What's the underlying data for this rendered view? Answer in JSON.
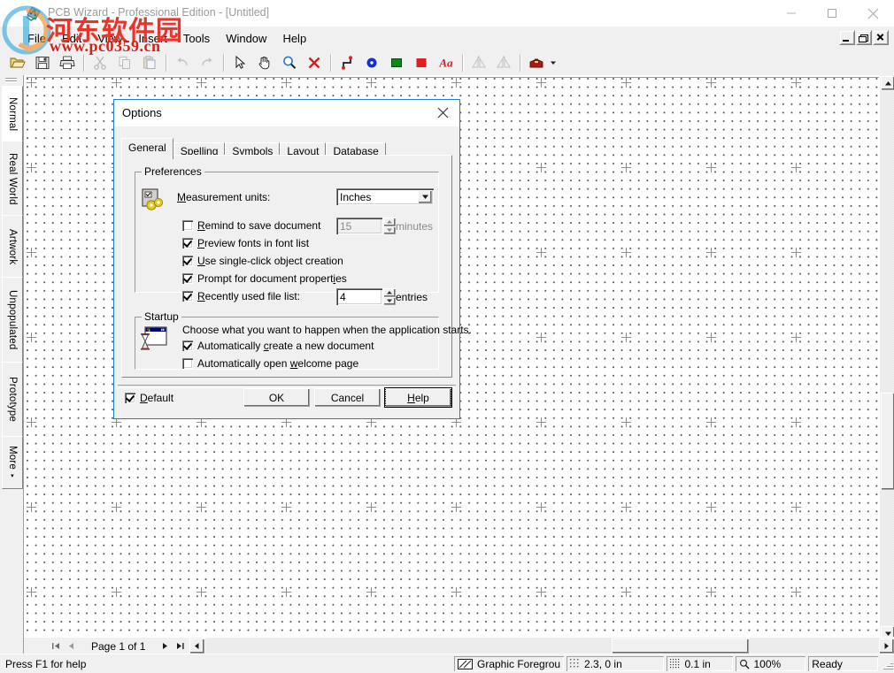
{
  "window": {
    "title": "PCB Wizard - Professional Edition - [Untitled]",
    "app_icon": "pcb-app-icon",
    "controls": {
      "minimize": "minimize-icon",
      "maximize": "maximize-icon",
      "close": "close-icon"
    }
  },
  "menubar": {
    "items": [
      {
        "label": "File"
      },
      {
        "label": "Edit"
      },
      {
        "label": "View"
      },
      {
        "label": "Insert"
      },
      {
        "label": "Tools"
      },
      {
        "label": "Window"
      },
      {
        "label": "Help"
      }
    ],
    "mdi_controls": {
      "minimize": "mdi-minimize-icon",
      "restore": "mdi-restore-icon",
      "close": "mdi-close-icon"
    }
  },
  "toolbar": {
    "buttons": [
      {
        "name": "open-icon",
        "title": "Open",
        "enabled": true
      },
      {
        "name": "save-icon",
        "title": "Save",
        "enabled": true
      },
      {
        "name": "print-icon",
        "title": "Print",
        "enabled": true
      },
      {
        "name": "cut-icon",
        "title": "Cut",
        "enabled": false
      },
      {
        "name": "copy-icon",
        "title": "Copy",
        "enabled": false
      },
      {
        "name": "paste-icon",
        "title": "Paste",
        "enabled": false
      },
      {
        "name": "undo-icon",
        "title": "Undo",
        "enabled": false
      },
      {
        "name": "redo-icon",
        "title": "Redo",
        "enabled": false
      },
      {
        "name": "select-arrow-icon",
        "title": "Select",
        "enabled": true
      },
      {
        "name": "pan-hand-icon",
        "title": "Pan",
        "enabled": true
      },
      {
        "name": "zoom-icon",
        "title": "Zoom",
        "enabled": true
      },
      {
        "name": "delete-x-icon",
        "title": "Delete",
        "enabled": true
      },
      {
        "name": "track-icon",
        "title": "Track",
        "enabled": true
      },
      {
        "name": "pad-icon",
        "title": "Pad",
        "enabled": true
      },
      {
        "name": "green-square-icon",
        "title": "Component",
        "enabled": true
      },
      {
        "name": "red-square-icon",
        "title": "Copper Area",
        "enabled": true
      },
      {
        "name": "text-aa-icon",
        "title": "Text",
        "enabled": true
      },
      {
        "name": "flip-left-icon",
        "title": "Flip Horizontal",
        "enabled": false
      },
      {
        "name": "flip-right-icon",
        "title": "Flip Vertical",
        "enabled": false
      },
      {
        "name": "toolbox-icon",
        "title": "Gallery",
        "enabled": true
      }
    ],
    "dropdown_arrow": "chevron-down-icon"
  },
  "sidebar": {
    "tabs": [
      {
        "label": "Normal",
        "selected": true
      },
      {
        "label": "Real World",
        "selected": false
      },
      {
        "label": "Artwork",
        "selected": false
      },
      {
        "label": "Unpopulated",
        "selected": false
      },
      {
        "label": "Prototype",
        "selected": false
      },
      {
        "label": "More",
        "selected": false,
        "caret": "▾"
      }
    ]
  },
  "pagebar": {
    "first": "first-page-icon",
    "prev": "prev-page-icon",
    "label": "Page 1 of 1",
    "next": "next-page-icon",
    "last": "last-page-icon",
    "scroll_left": "scroll-left-icon",
    "scroll_right": "scroll-right-icon"
  },
  "statusbar": {
    "message": "Press F1 for help",
    "layer": "Graphic Foregrou",
    "layer_icon": "layer-icon",
    "coordinates": "2.3, 0 in",
    "coordinates_icon": "coordinates-icon",
    "grid": "0.1 in",
    "grid_icon": "grid-icon",
    "zoom": "100%",
    "zoom_icon": "magnifier-icon",
    "state": "Ready"
  },
  "dialog": {
    "title": "Options",
    "close_icon": "close-icon",
    "tabs": [
      {
        "label": "General",
        "active": true
      },
      {
        "label": "Spelling",
        "active": false
      },
      {
        "label": "Symbols",
        "active": false
      },
      {
        "label": "Layout",
        "active": false
      },
      {
        "label": "Database",
        "active": false
      }
    ],
    "preferences": {
      "group_label": "Preferences",
      "icon": "preferences-gears-icon",
      "measurement_units": {
        "label": "Measurement units:",
        "accel": "M",
        "value": "Inches",
        "arrow": "chevron-down-icon"
      },
      "remind_to_save": {
        "label": "Remind to save document",
        "accel": "R",
        "checked": false,
        "value": "15",
        "unit": "minutes",
        "enabled": false
      },
      "preview_fonts": {
        "label": "Preview fonts in font list",
        "accel": "P",
        "checked": true
      },
      "single_click": {
        "label": "Use single-click object creation",
        "accel": "U",
        "checked": true
      },
      "prompt_properties": {
        "label": "Prompt for document properties",
        "accel": "i",
        "checked": true
      },
      "recent_files": {
        "label": "Recently used file list:",
        "accel": "R",
        "checked": true,
        "value": "4",
        "unit": "entries",
        "enabled": true
      }
    },
    "startup": {
      "group_label": "Startup",
      "icon": "startup-hourglass-icon",
      "description": "Choose what you want to happen when the application starts.",
      "auto_create": {
        "label": "Automatically create a new document",
        "accel": "c",
        "checked": true
      },
      "auto_welcome": {
        "label": "Automatically open welcome page",
        "accel": "w",
        "checked": false
      }
    },
    "footer": {
      "default": {
        "label": "Default",
        "accel": "D",
        "checked": true
      },
      "ok": "OK",
      "cancel": "Cancel",
      "help": "Help"
    }
  },
  "watermark": {
    "chinese": "河东软件园",
    "url": "www.pc0359.cn"
  },
  "colors": {
    "accent": "#1b7fd4",
    "grid_mark": "#e8685e",
    "face": "#f0f0f0",
    "watermark_red": "#e8352a"
  }
}
